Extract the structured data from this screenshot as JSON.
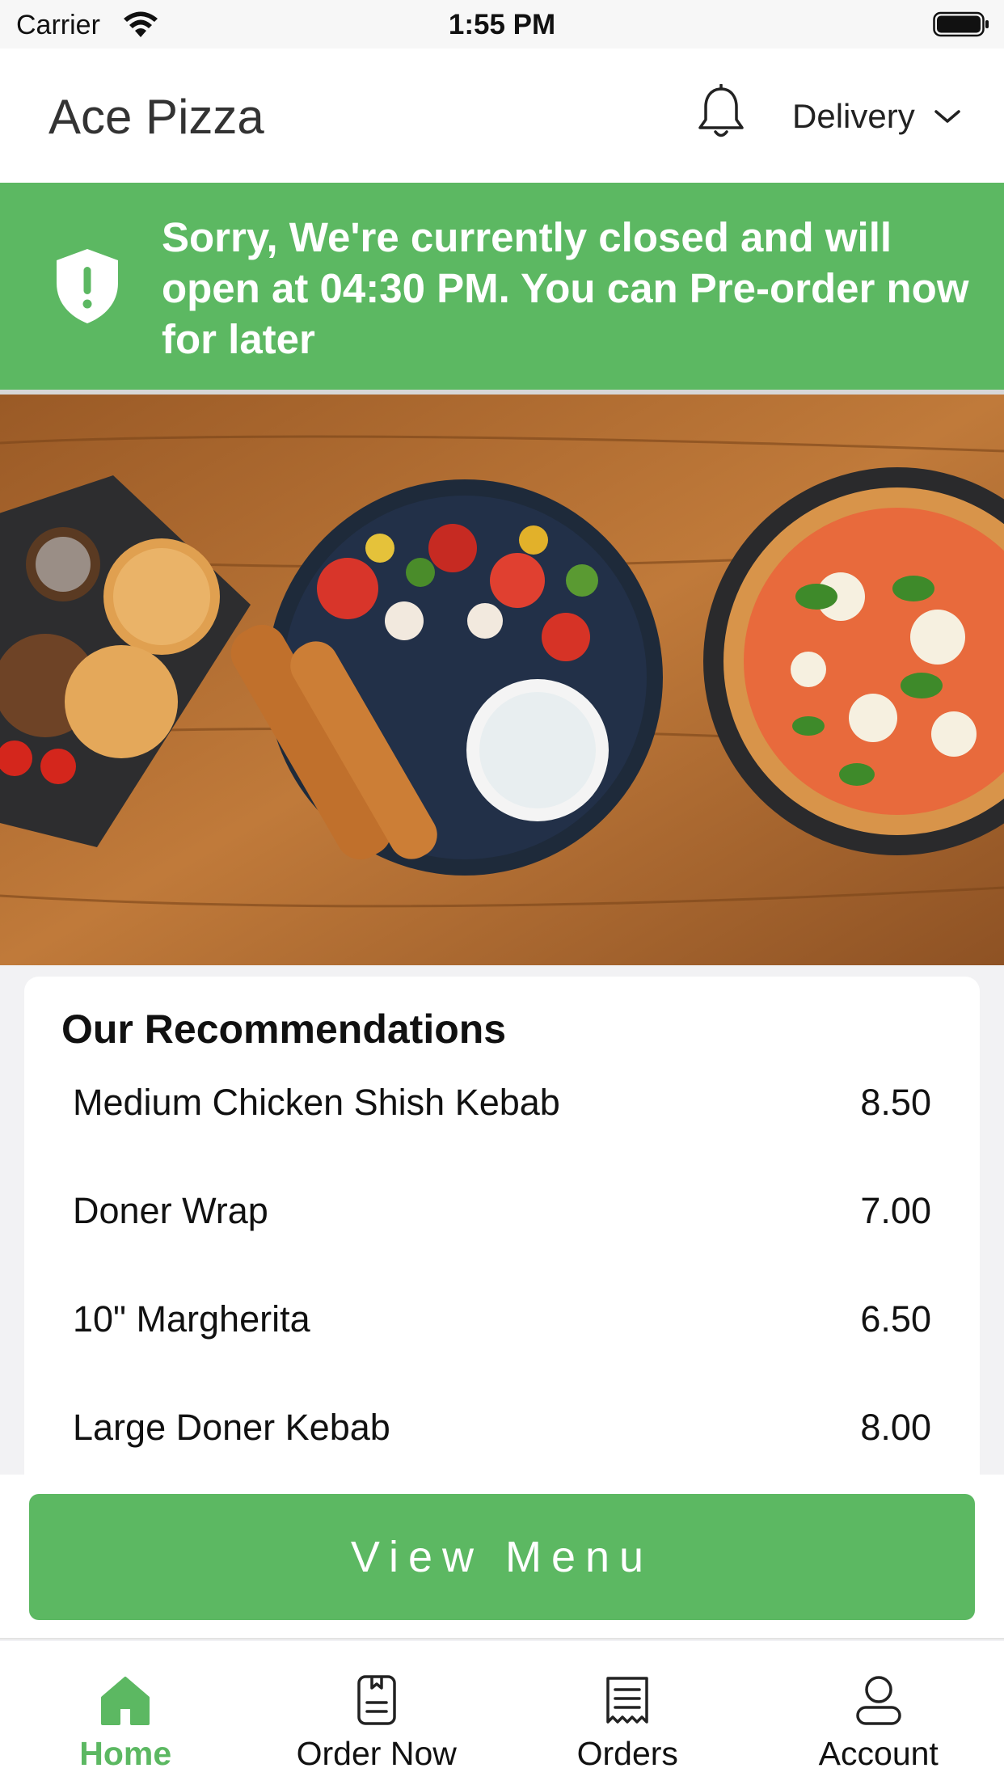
{
  "status_bar": {
    "carrier": "Carrier",
    "time": "1:55 PM"
  },
  "header": {
    "title": "Ace Pizza",
    "order_type": "Delivery",
    "icons": [
      "bell-icon",
      "chevron-down-icon"
    ]
  },
  "banner": {
    "message": "Sorry, We're currently closed and will open at 04:30 PM. You can Pre-order now for later",
    "icon": "shield-exclamation-icon"
  },
  "recommendations": {
    "title": "Our Recommendations",
    "items": [
      {
        "name": "Medium Chicken Shish Kebab",
        "price": "8.50"
      },
      {
        "name": "Doner Wrap",
        "price": "7.00"
      },
      {
        "name": "10\" Margherita",
        "price": "6.50"
      },
      {
        "name": "Large Doner Kebab",
        "price": "8.00"
      }
    ]
  },
  "actions": {
    "view_menu": "View Menu"
  },
  "tabs": [
    {
      "label": "Home",
      "icon": "home-icon",
      "active": true
    },
    {
      "label": "Order Now",
      "icon": "menu-book-icon",
      "active": false
    },
    {
      "label": "Orders",
      "icon": "receipt-icon",
      "active": false
    },
    {
      "label": "Account",
      "icon": "user-icon",
      "active": false
    }
  ],
  "colors": {
    "accent": "#5cb862",
    "header_bg": "#ffffff",
    "page_bg": "#f2f2f4"
  }
}
